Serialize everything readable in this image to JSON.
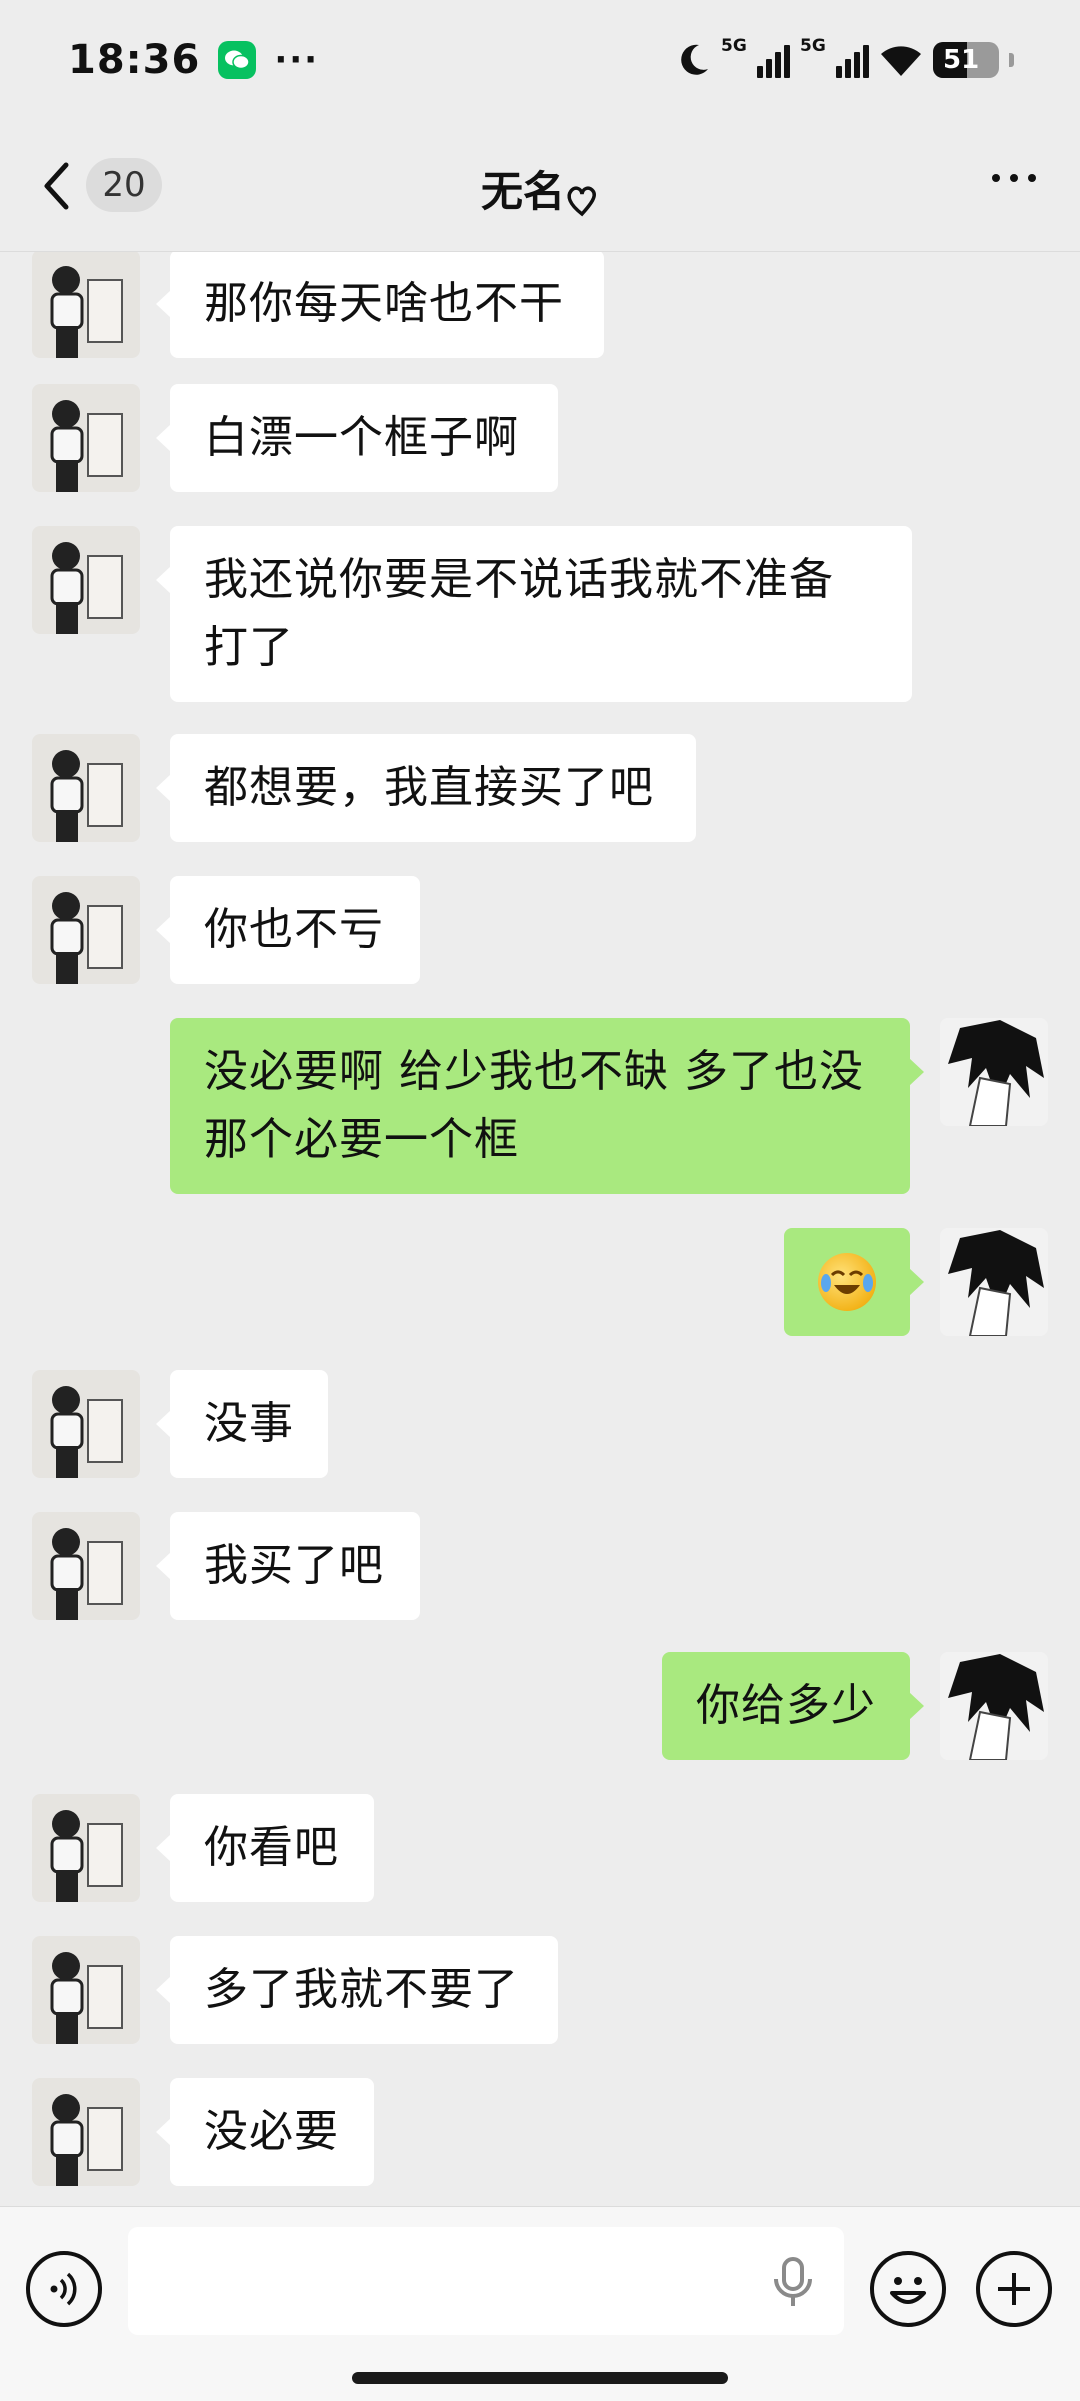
{
  "status_bar": {
    "time": "18:36",
    "more": "···",
    "network_tag_1": "5G",
    "network_tag_2": "5G",
    "battery": "51"
  },
  "nav": {
    "unread_count": "20",
    "title": "无名",
    "title_icon": "heart-outline-icon"
  },
  "messages": [
    {
      "side": "left",
      "text": "那你每天啥也不干"
    },
    {
      "side": "left",
      "text": "白漂一个框子啊"
    },
    {
      "side": "left",
      "text": "我还说你要是不说话我就不准备打了"
    },
    {
      "side": "left",
      "text": "都想要，我直接买了吧"
    },
    {
      "side": "left",
      "text": "你也不亏"
    },
    {
      "side": "right",
      "text": "没必要啊 给少我也不缺 多了也没那个必要一个框"
    },
    {
      "side": "right",
      "text": "",
      "emoji": "laughing-crying-emoji"
    },
    {
      "side": "left",
      "text": "没事"
    },
    {
      "side": "left",
      "text": "我买了吧"
    },
    {
      "side": "right",
      "text": "你给多少"
    },
    {
      "side": "left",
      "text": "你看吧"
    },
    {
      "side": "left",
      "text": "多了我就不要了"
    },
    {
      "side": "left",
      "text": "没必要"
    }
  ],
  "input": {
    "value": "",
    "placeholder": ""
  },
  "colors": {
    "background": "#ededed",
    "sent_bubble": "#a9e97f",
    "received_bubble": "#ffffff",
    "wechat_green": "#07c160"
  }
}
